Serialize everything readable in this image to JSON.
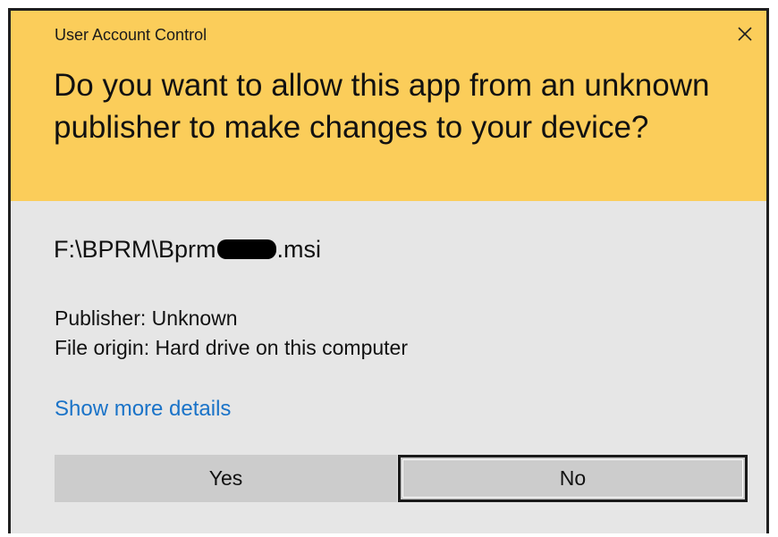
{
  "dialog": {
    "title": "User Account Control",
    "question": "Do you want to allow this app from an unknown publisher to make changes to your device?",
    "file_name_prefix": "F:\\BPRM\\Bprm",
    "file_name_suffix": ".msi",
    "publisher": "Publisher: Unknown",
    "file_origin": "File origin: Hard drive on this computer",
    "more_details_label": "Show more details",
    "yes_label": "Yes",
    "no_label": "No"
  },
  "colors": {
    "header_background": "#fbcd5a",
    "body_background": "#e6e6e6",
    "link": "#1a73c8",
    "button_background": "#cccccc"
  },
  "icons": {
    "close": "close-icon"
  }
}
